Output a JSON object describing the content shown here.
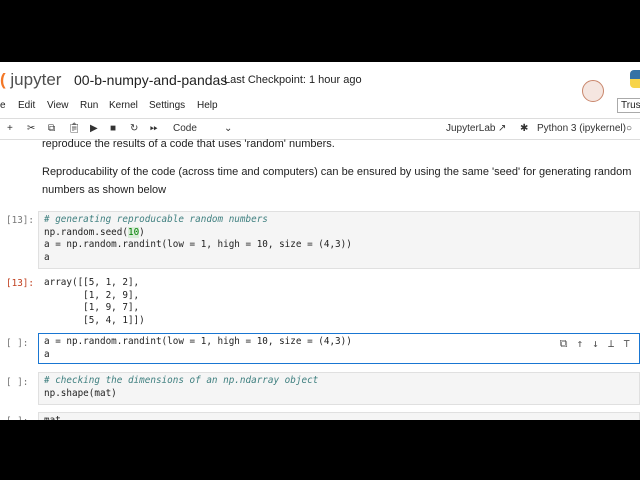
{
  "header": {
    "logo": "jupyter",
    "notebook_title": "00-b-numpy-and-pandas",
    "checkpoint": "Last Checkpoint: 1 hour ago",
    "trust": "Trust"
  },
  "menu": [
    "e",
    "Edit",
    "View",
    "Run",
    "Kernel",
    "Settings",
    "Help"
  ],
  "toolbar": {
    "cell_type": "Code",
    "jupyterlab": "JupyterLab",
    "kernel": "Python 3 (ipykernel)"
  },
  "markdown": {
    "line0": "reproduce the results of a code that uses 'random' numbers.",
    "para1": "Reproducability of the code (across time and computers) can be ensured by using the same 'seed' for generating random numbers as shown below"
  },
  "cells": [
    {
      "prompt": "[13]:",
      "comment": "# generating reproducable random numbers",
      "seed_pre": "np.random.seed(",
      "seed_arg": "10",
      "seed_post": ")",
      "line3": "a = np.random.randint(low = 1, high = 10, size = (4,3))",
      "line4": "a"
    },
    {
      "prompt": "[13]:",
      "output": "array([[5, 1, 2],\n       [1, 2, 9],\n       [1, 9, 7],\n       [5, 4, 1]])"
    },
    {
      "prompt": "[ ]:",
      "line1": "a = np.random.randint(low = 1, high = 10, size = (4,3))",
      "line2": "a"
    },
    {
      "prompt": "[ ]:",
      "comment": "# checking the dimensions of an np.ndarray object",
      "line2": "np.shape(mat)"
    },
    {
      "prompt": "[ ]:",
      "line1": "mat"
    }
  ]
}
